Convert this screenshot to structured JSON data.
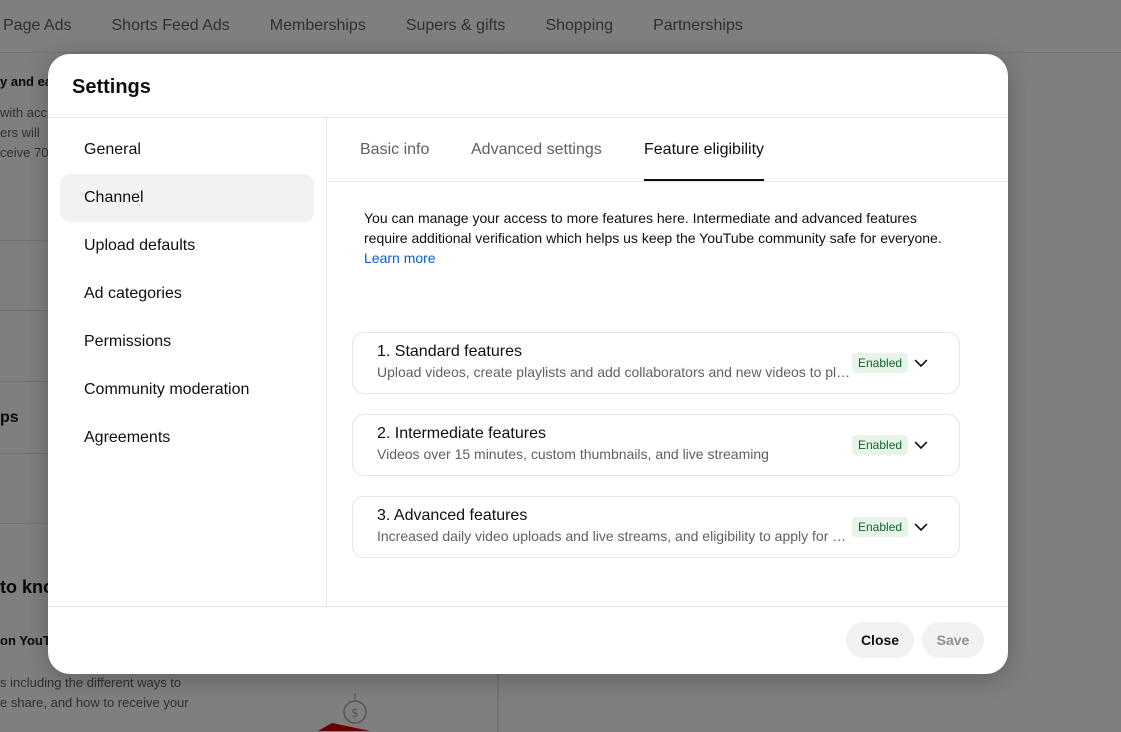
{
  "background": {
    "tabs": [
      "Page Ads",
      "Shorts Feed Ads",
      "Memberships",
      "Supers & gifts",
      "Shopping",
      "Partnerships"
    ],
    "fragments": [
      "y and ea",
      "with acc",
      "ers will",
      "ceive 70",
      "ps",
      "to kno",
      "on YouT",
      "s including the different ways to",
      "e share, and how to receive your"
    ]
  },
  "dialog": {
    "title": "Settings",
    "sidebar": [
      {
        "label": "General",
        "active": false
      },
      {
        "label": "Channel",
        "active": true
      },
      {
        "label": "Upload defaults",
        "active": false
      },
      {
        "label": "Ad categories",
        "active": false
      },
      {
        "label": "Permissions",
        "active": false
      },
      {
        "label": "Community moderation",
        "active": false
      },
      {
        "label": "Agreements",
        "active": false
      }
    ],
    "tabs": [
      {
        "label": "Basic info",
        "active": false
      },
      {
        "label": "Advanced settings",
        "active": false
      },
      {
        "label": "Feature eligibility",
        "active": true
      }
    ],
    "description": "You can manage your access to more features here. Intermediate and advanced features require additional verification which helps us keep the YouTube community safe for everyone.",
    "learn_more": "Learn more",
    "features": [
      {
        "title": "1. Standard features",
        "subtitle": "Upload videos, create playlists and add collaborators and new videos to playlists",
        "status": "Enabled"
      },
      {
        "title": "2. Intermediate features",
        "subtitle": "Videos over 15 minutes, custom thumbnails, and live streaming",
        "status": "Enabled"
      },
      {
        "title": "3. Advanced features",
        "subtitle": "Increased daily video uploads and live streams, and eligibility to apply for monetization",
        "status": "Enabled"
      }
    ],
    "close_label": "Close",
    "save_label": "Save"
  },
  "colors": {
    "accent_link": "#065fd4",
    "badge_bg": "#e6f4ea",
    "badge_text": "#0d652d"
  },
  "icons": {
    "feature_expand": "chevron-down-icon",
    "bg_illustration": "dollar-coin-icon"
  }
}
